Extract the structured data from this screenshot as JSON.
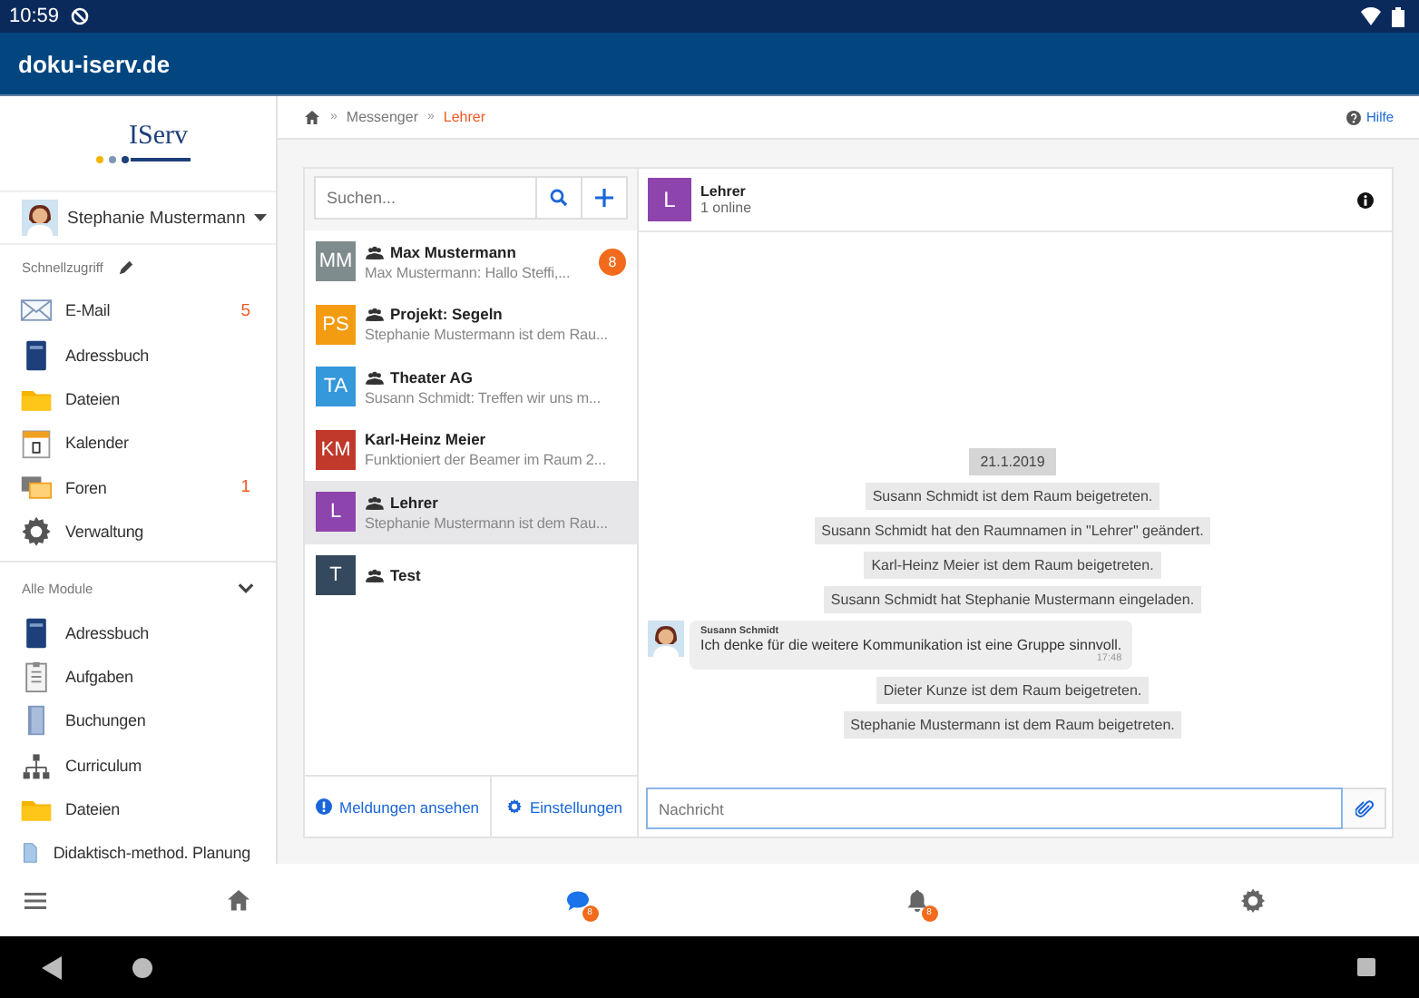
{
  "status_bar": {
    "time": "10:59"
  },
  "app_bar": {
    "title": "doku-iserv.de"
  },
  "sidebar": {
    "logo": "IServ",
    "user": "Stephanie Mustermann",
    "quick_access": {
      "title": "Schnellzugriff",
      "items": [
        {
          "kind": "mail",
          "label": "E-Mail",
          "badge": "5"
        },
        {
          "kind": "book",
          "label": "Adressbuch"
        },
        {
          "kind": "folder",
          "label": "Dateien"
        },
        {
          "kind": "calendar",
          "label": "Kalender"
        },
        {
          "kind": "forum",
          "label": "Foren",
          "badge": "1"
        },
        {
          "kind": "gear",
          "label": "Verwaltung"
        }
      ]
    },
    "all_modules": {
      "title": "Alle Module",
      "expanded": true,
      "items": [
        {
          "kind": "book",
          "label": "Adressbuch"
        },
        {
          "kind": "tasks",
          "label": "Aufgaben"
        },
        {
          "kind": "door",
          "label": "Buchungen"
        },
        {
          "kind": "tree",
          "label": "Curriculum"
        },
        {
          "kind": "folder",
          "label": "Dateien"
        },
        {
          "kind": "doc",
          "label": "Didaktisch-method. Planung"
        }
      ]
    }
  },
  "breadcrumb": {
    "items": [
      {
        "separator": "»",
        "label": "Messenger",
        "current": false
      },
      {
        "separator": "»",
        "label": "Lehrer",
        "current": true
      }
    ],
    "help": "Hilfe"
  },
  "rooms": {
    "search": {
      "placeholder": "Suchen..."
    },
    "items": [
      {
        "initials": "MM",
        "color": "#7f8c8d",
        "group": true,
        "name": "Max Mustermann",
        "preview": "Max Mustermann: Hallo Steffi,...",
        "unread": "8",
        "selected": false
      },
      {
        "initials": "PS",
        "color": "#f39c12",
        "group": true,
        "name": "Projekt: Segeln",
        "preview": "Stephanie Mustermann ist dem Rau...",
        "selected": false
      },
      {
        "initials": "TA",
        "color": "#3498db",
        "group": true,
        "name": "Theater AG",
        "preview": "Susann Schmidt: Treffen wir uns m...",
        "selected": false
      },
      {
        "initials": "KM",
        "color": "#c0392b",
        "group": false,
        "name": "Karl-Heinz Meier",
        "preview": "Funktioniert der Beamer im Raum 2...",
        "selected": false
      },
      {
        "initials": "L",
        "color": "#8e44ad",
        "group": true,
        "name": "Lehrer",
        "preview": "Stephanie Mustermann ist dem Rau...",
        "selected": true
      },
      {
        "initials": "T",
        "color": "#34495e",
        "group": true,
        "name": "Test",
        "selected": false
      }
    ],
    "footer": [
      "Meldungen ansehen",
      "Einstellungen"
    ]
  },
  "chat": {
    "initials": "L",
    "color": "#8e44ad",
    "title": "Lehrer",
    "subtitle": "1 online",
    "messages": [
      {
        "kind": "date",
        "text": "21.1.2019"
      },
      {
        "kind": "event",
        "text": "Susann Schmidt ist dem Raum beigetreten."
      },
      {
        "kind": "event",
        "text": "Susann Schmidt hat den Raumnamen in \"Lehrer\" geändert."
      },
      {
        "kind": "event",
        "text": "Karl-Heinz Meier ist dem Raum beigetreten."
      },
      {
        "kind": "event",
        "text": "Susann Schmidt hat Stephanie Mustermann eingeladen."
      },
      {
        "kind": "message",
        "sender": "Susann Schmidt",
        "text": "Ich denke für die weitere Kommunikation ist eine Gruppe sinnvoll.",
        "time": "17:48"
      },
      {
        "kind": "event",
        "text": "Dieter Kunze ist dem Raum beigetreten."
      },
      {
        "kind": "event",
        "text": "Stephanie Mustermann ist dem Raum beigetreten."
      }
    ],
    "input": {
      "placeholder": "Nachricht"
    }
  },
  "bottom_nav": [
    {
      "kind": "menu",
      "selected": false
    },
    {
      "kind": "home",
      "selected": false
    },
    {
      "kind": "chat",
      "selected": true,
      "badge": "8"
    },
    {
      "kind": "bell",
      "selected": false,
      "badge": "8"
    },
    {
      "kind": "gear",
      "selected": false
    }
  ]
}
